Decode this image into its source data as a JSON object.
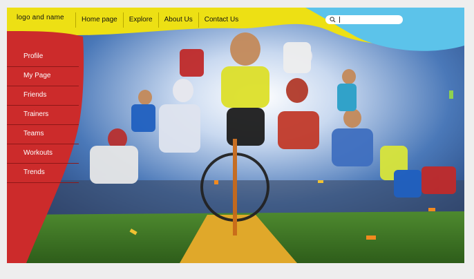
{
  "header": {
    "logo_text": "logo and name",
    "nav": [
      "Home page",
      "Explore",
      "About Us",
      "Contact Us"
    ]
  },
  "search": {
    "placeholder": "",
    "icon": "search-icon"
  },
  "sidebar": {
    "items": [
      "Profile",
      "My Page",
      "Friends",
      "Trainers",
      "Teams",
      "Workouts",
      "Trends"
    ]
  },
  "colors": {
    "header_yellow": "#ede014",
    "header_blue": "#5cc3ea",
    "sidebar_red": "#cc2b2b",
    "hero_sky": "#2c5aa0"
  }
}
